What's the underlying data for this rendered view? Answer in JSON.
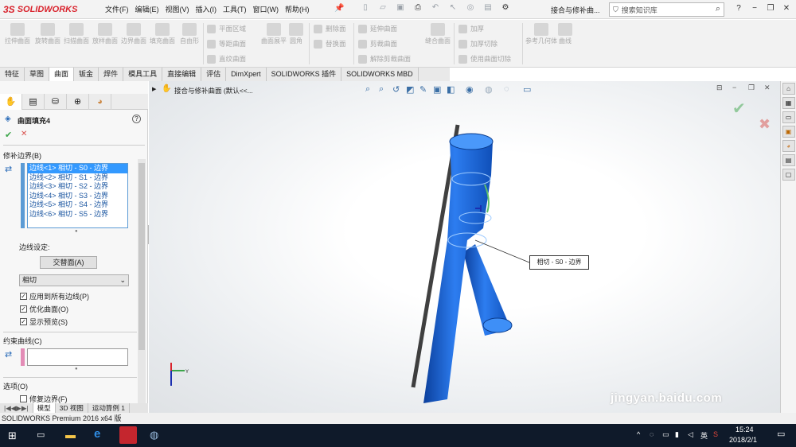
{
  "app": {
    "logo_ds": "3S",
    "logo_name": "SOLIDWORKS",
    "document_title": "接合与修补曲...",
    "search_placeholder": "搜索知识库"
  },
  "menu": [
    "文件(F)",
    "编辑(E)",
    "视图(V)",
    "插入(I)",
    "工具(T)",
    "窗口(W)",
    "帮助(H)"
  ],
  "command_manager": {
    "big_buttons": [
      "拉伸曲面",
      "旋转曲面",
      "扫描曲面",
      "放样曲面",
      "边界曲面",
      "填充曲面",
      "自由形",
      "曲面展平",
      "圆角",
      "缝合曲面",
      "参考几何体",
      "曲线"
    ],
    "small_buttons": [
      "平面区域",
      "等距曲面",
      "直纹曲面",
      "删除面",
      "替换面",
      "延伸曲面",
      "剪裁曲面",
      "解除剪裁曲面",
      "加厚",
      "加厚切除",
      "使用曲面切除"
    ]
  },
  "tabs": [
    "特征",
    "草图",
    "曲面",
    "钣金",
    "焊件",
    "模具工具",
    "直接编辑",
    "评估",
    "DimXpert",
    "SOLIDWORKS 插件",
    "SOLIDWORKS MBD"
  ],
  "active_tab": "曲面",
  "property_manager": {
    "title": "曲面填充4",
    "help": "?",
    "ok": "✔",
    "cancel": "✕",
    "patch_boundary_header": "修补边界(B)",
    "edges": [
      "边线<1> 相切 - S0 - 边界",
      "边线<2> 相切 - S1 - 边界",
      "边线<3> 相切 - S2 - 边界",
      "边线<4> 相切 - S3 - 边界",
      "边线<5> 相切 - S4 - 边界",
      "边线<6> 相切 - S5 - 边界"
    ],
    "edge_settings_label": "边线设定:",
    "alternate_face_button": "交替面(A)",
    "condition_select": "相切",
    "apply_all_edges": "应用到所有边线(P)",
    "optimize_surface": "优化曲面(O)",
    "show_preview": "显示预览(S)",
    "constraint_curves_header": "约束曲线(C)",
    "options_header": "选项(O)",
    "fix_boundary": "修复边界(F)"
  },
  "bottom_tabs": [
    "模型",
    "3D 视图",
    "运动算例 1"
  ],
  "status_text": "SOLIDWORKS Premium 2016 x64 版",
  "viewport": {
    "tree_label": "接合与修补曲面 (默认<<...",
    "callout": "相切 - S0 - 边界"
  },
  "taskbar": {
    "ime": "英",
    "time": "15:24",
    "date": "2018/2/1"
  },
  "watermark": "jingyan.baidu.com",
  "colors": {
    "brand": "#d9232d",
    "tube": "#1f6fe0",
    "selection": "#3399ff",
    "accept": "#3ca64a",
    "reject": "#d9534f"
  }
}
